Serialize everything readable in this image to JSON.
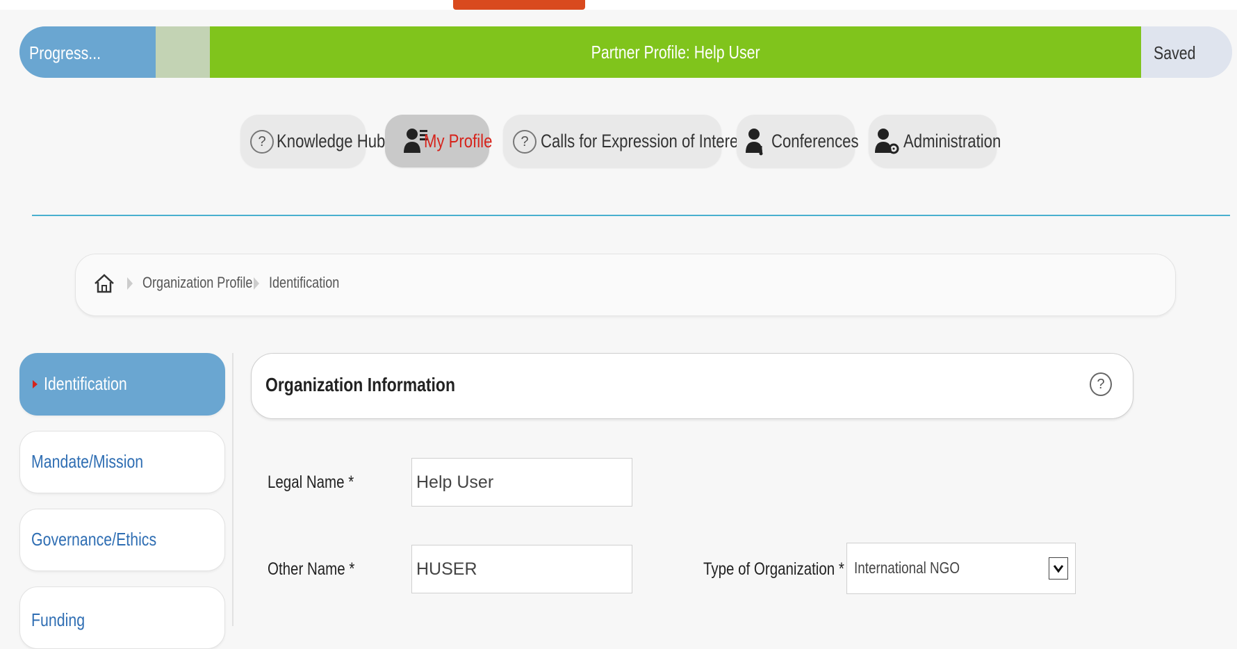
{
  "progress": {
    "label": "Progress...",
    "title": "Partner Profile: Help User",
    "status": "Saved",
    "colors": {
      "label_bg": "#6aa6d1",
      "fill": "#80c41c",
      "pending": "#c3d3b4",
      "status_bg": "#dfe4ee"
    }
  },
  "nav": {
    "tabs": [
      {
        "label": "Knowledge Hub",
        "icon": "help-circle-icon",
        "active": false
      },
      {
        "label": "My Profile",
        "icon": "user-profile-icon",
        "active": true
      },
      {
        "label": "Calls for Expression of Interest",
        "icon": "help-circle-icon",
        "active": false
      },
      {
        "label": "Conferences",
        "icon": "user-headset-icon",
        "active": false
      },
      {
        "label": "Administration",
        "icon": "user-gear-icon",
        "active": false
      }
    ],
    "help_glyph": "?"
  },
  "breadcrumb": {
    "home_icon": "home-icon",
    "items": [
      "Organization Profile",
      "Identification"
    ]
  },
  "sidebar": {
    "items": [
      {
        "label": "Identification",
        "active": true
      },
      {
        "label": "Mandate/Mission",
        "active": false
      },
      {
        "label": "Governance/Ethics",
        "active": false
      },
      {
        "label": "Funding",
        "active": false
      }
    ]
  },
  "section": {
    "title": "Organization Information",
    "help_glyph": "?"
  },
  "form": {
    "legal_name": {
      "label": "Legal Name *",
      "value": "Help User"
    },
    "other_name": {
      "label": "Other Name *",
      "value": "HUSER"
    },
    "org_type": {
      "label": "Type of Organization *",
      "value": "International NGO"
    }
  }
}
